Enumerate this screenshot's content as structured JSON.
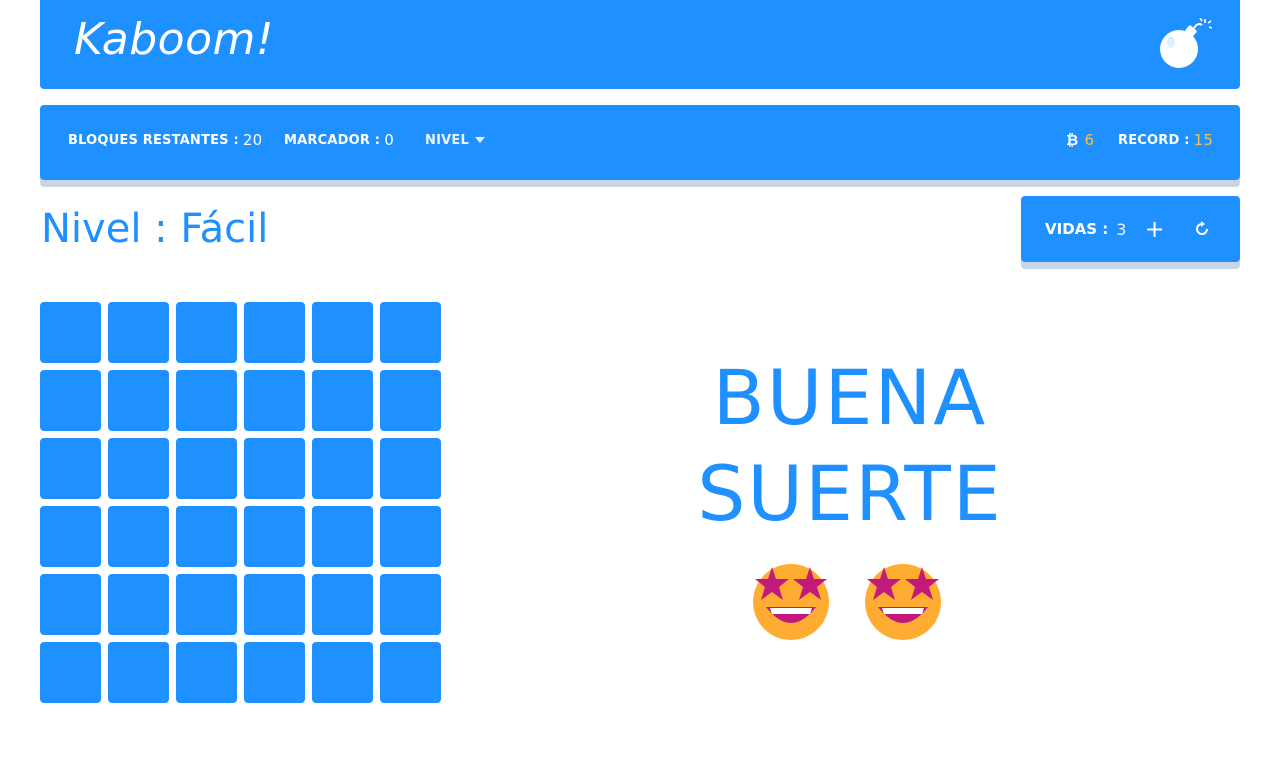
{
  "header": {
    "brand": "Kaboom!",
    "icon": "bomb-icon"
  },
  "status": {
    "remaining_label": "BLOQUES RESTANTES :",
    "remaining_value": "20",
    "score_label": "MARCADOR :",
    "score_value": "0",
    "level_menu_label": "NIVEL",
    "coins_icon": "bitcoin-icon",
    "coins_value": "6",
    "record_label": "RECORD :",
    "record_value": "15"
  },
  "level": {
    "title": "Nivel : Fácil"
  },
  "lives": {
    "label": "VIDAS :",
    "value": "3",
    "add_icon": "plus-icon",
    "reset_icon": "refresh-icon"
  },
  "board": {
    "rows": 6,
    "cols": 6
  },
  "message": {
    "line1": "BUENA",
    "line2": "SUERTE",
    "emoji_icon": "star-struck-face-icon"
  },
  "colors": {
    "primary": "#1e90ff",
    "accent_gold": "#f2c14e",
    "shadow": "#c9d6e3"
  }
}
